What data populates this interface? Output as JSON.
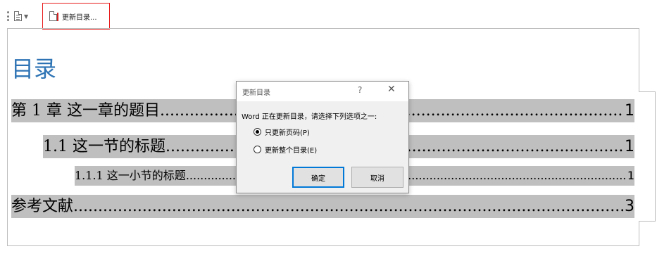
{
  "toolbar": {
    "update_button_label": "更新目录..."
  },
  "document": {
    "toc_heading": "目录",
    "entries": [
      {
        "label": "第 1 章  这一章的题目",
        "page": "1"
      },
      {
        "label": "1.1  这一节的标题",
        "page": "1"
      },
      {
        "label": "1.1.1  这一小节的标题",
        "page": "1"
      },
      {
        "label": "参考文献",
        "page": "3"
      }
    ]
  },
  "dialog": {
    "title": "更新目录",
    "help": "?",
    "close": "✕",
    "message": "Word 正在更新目录，请选择下列选项之一:",
    "options": [
      {
        "label": "只更新页码(P)",
        "selected": true
      },
      {
        "label": "更新整个目录(E)",
        "selected": false
      }
    ],
    "ok_label": "确定",
    "cancel_label": "取消"
  }
}
